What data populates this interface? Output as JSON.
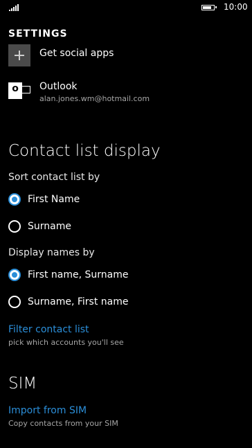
{
  "status_bar": {
    "time": "10:00",
    "battery_level": 0.85,
    "signal_bars": 5
  },
  "header": {
    "title": "SETTINGS"
  },
  "accounts": [
    {
      "name": "Get social apps",
      "icon": "plus-icon"
    },
    {
      "name": "Outlook",
      "email": "alan.jones.wm@hotmail.com",
      "icon": "outlook-icon"
    }
  ],
  "contact_list_display": {
    "title": "Contact list display",
    "sort_label": "Sort contact list by",
    "sort_options": [
      {
        "label": "First Name",
        "selected": true
      },
      {
        "label": "Surname",
        "selected": false
      }
    ],
    "display_label": "Display names by",
    "display_options": [
      {
        "label": "First name, Surname",
        "selected": true
      },
      {
        "label": "Surname, First name",
        "selected": false
      }
    ],
    "filter": {
      "label": "Filter contact list",
      "description": "pick which accounts you'll see"
    }
  },
  "sim": {
    "title": "SIM",
    "import": {
      "label": "Import from SIM",
      "description": "Copy contacts from your SIM"
    }
  },
  "colors": {
    "accent": "#2b8ed8",
    "background": "#000000",
    "secondary_text": "#a6a6a6"
  }
}
